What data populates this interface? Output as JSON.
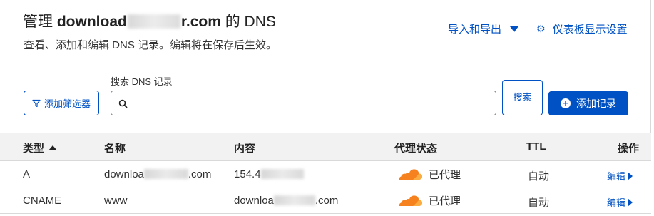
{
  "header": {
    "title_prefix": "管理",
    "domain_start": "download",
    "domain_end": "r.com",
    "title_suffix": "的 DNS",
    "subtitle": "查看、添加和编辑 DNS 记录。编辑将在保存后生效。",
    "import_export_label": "导入和导出",
    "dashboard_settings_label": "仪表板显示设置"
  },
  "toolbar": {
    "filter_label": "添加筛选器",
    "search_label": "搜索 DNS 记录",
    "search_value": "",
    "search_button_label": "搜索",
    "add_record_label": "添加记录"
  },
  "table": {
    "columns": [
      "类型",
      "名称",
      "内容",
      "代理状态",
      "TTL",
      "操作"
    ],
    "sorted_column": "类型",
    "sort_direction": "ascending",
    "rows": [
      {
        "type": "A",
        "name_start": "downloa",
        "name_end": ".com",
        "content_start": "154.4",
        "content_end": "",
        "proxy": "已代理",
        "ttl": "自动",
        "action": "编辑"
      },
      {
        "type": "CNAME",
        "name_start": "www",
        "name_end": "",
        "content_start": "downloa",
        "content_end": ".com",
        "proxy": "已代理",
        "ttl": "自动",
        "action": "编辑"
      }
    ]
  },
  "colors": {
    "accent": "#0051c3",
    "cloud_orange": "#f6821f",
    "cloud_light": "#fbad41",
    "header_bg": "#f2f2f2"
  },
  "icons": {
    "caret": "caret-down-icon",
    "gear": "gear-icon",
    "filter": "funnel-icon",
    "search": "search-icon",
    "add": "plus-circle-icon",
    "proxy": "cloud-icon",
    "edit_arrow": "caret-right-icon",
    "sort": "sort-ascending-icon"
  }
}
